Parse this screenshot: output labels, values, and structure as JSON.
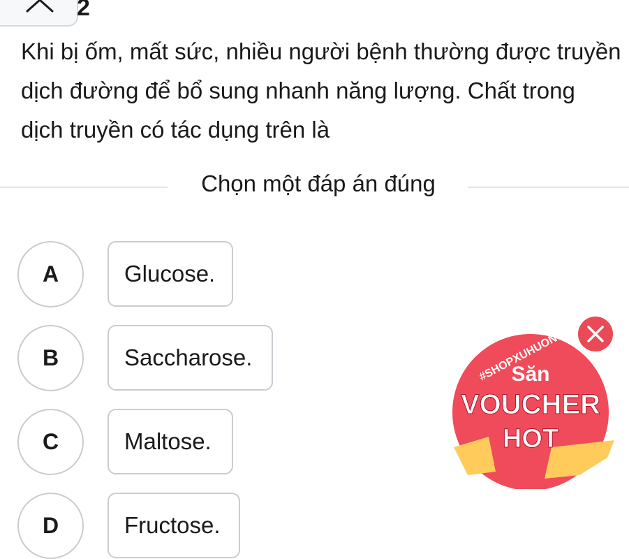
{
  "header": {
    "question_number": "2"
  },
  "question": {
    "text": "Khi bị ốm, mất sức, nhiều người bệnh thường được truyền dịch đường để bổ sung nhanh năng lượng. Chất trong dịch truyền có tác dụng trên là"
  },
  "instruction": "Chọn một đáp án đúng",
  "options": [
    {
      "letter": "A",
      "text": "Glucose."
    },
    {
      "letter": "B",
      "text": "Saccharose."
    },
    {
      "letter": "C",
      "text": "Maltose."
    },
    {
      "letter": "D",
      "text": "Fructose."
    }
  ],
  "promo": {
    "hashtag": "#SHOPXUHUONG",
    "line1": "Săn",
    "line2": "VOUCHER",
    "line3": "HOT",
    "colors": {
      "badge": "#f04b5a",
      "close": "#e94a55",
      "ticket": "#ffcc5c"
    }
  }
}
